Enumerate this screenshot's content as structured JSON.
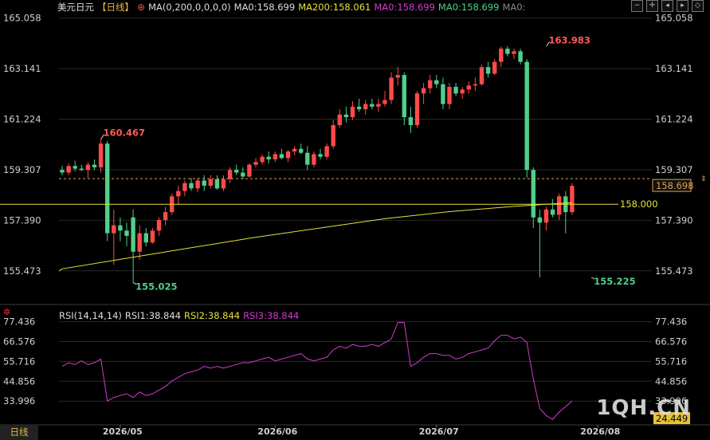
{
  "header": {
    "symbol": "美元日元",
    "period": "【日线】",
    "ma_params": "MA(0,200,0,0,0,0)",
    "ma0_label": "MA0:158.699",
    "ma200_label": "MA200:158.061",
    "ma0_label_2": "MA0:158.699",
    "ma0_label_3": "MA0:158.699",
    "ma0_label_4": "MA0:"
  },
  "rsi_header": {
    "params": "RSI(14,14,14)",
    "rsi1": "RSI1:38.844",
    "rsi2": "RSI2:38.844",
    "rsi3": "RSI3:38.844"
  },
  "bottom_tab": "日线",
  "watermark": "1QH.CN",
  "colors": {
    "up": "#ff4a4a",
    "down": "#4fd08a",
    "ma200": "#e6e03a",
    "rsi": "#d43bd1",
    "grid": "#2a2a2a",
    "support": "#e6e03a",
    "price_dash": "#e0a050"
  },
  "chart_data": [
    {
      "type": "candlestick",
      "y_ticks": [
        "165.058",
        "163.141",
        "161.224",
        "159.307",
        "157.390",
        "155.473"
      ],
      "ylim": [
        154.5,
        165.2
      ],
      "x_ticks": [
        "2026/05",
        "2026/06",
        "2026/07",
        "2026/08"
      ],
      "x_tick_index": [
        9,
        33,
        58,
        83
      ],
      "last_price": "158.698",
      "support_level": 158.0,
      "support_label": "158.000",
      "annotations": [
        {
          "text": "160.467",
          "index": 6,
          "value": 160.467,
          "kind": "high"
        },
        {
          "text": "155.025",
          "index": 11,
          "value": 155.025,
          "kind": "low"
        },
        {
          "text": "163.983",
          "index": 75,
          "value": 163.983,
          "kind": "high"
        },
        {
          "text": "155.225",
          "index": 82,
          "value": 155.225,
          "kind": "low"
        }
      ],
      "ohlc": [
        [
          159.3,
          159.45,
          159.1,
          159.2
        ],
        [
          159.2,
          159.55,
          159.1,
          159.45
        ],
        [
          159.45,
          159.65,
          159.25,
          159.35
        ],
        [
          159.35,
          159.5,
          159.25,
          159.3
        ],
        [
          159.3,
          159.6,
          159.0,
          159.5
        ],
        [
          159.5,
          159.7,
          159.3,
          159.4
        ],
        [
          159.4,
          160.467,
          159.2,
          160.3
        ],
        [
          160.3,
          160.4,
          156.6,
          156.9
        ],
        [
          156.9,
          157.8,
          155.7,
          157.2
        ],
        [
          157.2,
          157.5,
          156.6,
          157.0
        ],
        [
          157.0,
          157.3,
          156.4,
          156.8
        ],
        [
          157.5,
          157.8,
          155.025,
          156.2
        ],
        [
          156.2,
          157.2,
          155.9,
          156.9
        ],
        [
          156.9,
          157.1,
          156.4,
          156.55
        ],
        [
          156.55,
          157.1,
          156.5,
          157.0
        ],
        [
          157.0,
          157.5,
          156.8,
          157.4
        ],
        [
          157.4,
          157.9,
          157.2,
          157.7
        ],
        [
          157.7,
          158.4,
          157.6,
          158.3
        ],
        [
          158.3,
          158.7,
          158.0,
          158.5
        ],
        [
          158.5,
          158.9,
          158.3,
          158.8
        ],
        [
          158.8,
          159.0,
          158.5,
          158.6
        ],
        [
          158.6,
          159.0,
          158.45,
          158.9
        ],
        [
          158.9,
          159.1,
          158.5,
          158.7
        ],
        [
          158.7,
          159.1,
          158.6,
          158.95
        ],
        [
          158.95,
          159.1,
          158.55,
          158.6
        ],
        [
          158.6,
          159.1,
          158.5,
          158.95
        ],
        [
          158.95,
          159.4,
          158.8,
          159.3
        ],
        [
          159.3,
          159.5,
          159.1,
          159.2
        ],
        [
          159.2,
          159.4,
          158.95,
          159.05
        ],
        [
          159.05,
          159.55,
          159.0,
          159.5
        ],
        [
          159.5,
          159.75,
          159.4,
          159.6
        ],
        [
          159.6,
          159.9,
          159.5,
          159.8
        ],
        [
          159.8,
          160.0,
          159.55,
          159.7
        ],
        [
          159.7,
          160.0,
          159.6,
          159.9
        ],
        [
          159.9,
          160.1,
          159.7,
          159.75
        ],
        [
          159.75,
          160.05,
          159.6,
          160.0
        ],
        [
          160.0,
          160.2,
          159.85,
          160.1
        ],
        [
          160.1,
          160.3,
          159.9,
          159.95
        ],
        [
          159.95,
          160.2,
          159.3,
          159.5
        ],
        [
          159.5,
          160.0,
          159.4,
          159.9
        ],
        [
          159.9,
          160.1,
          159.7,
          159.8
        ],
        [
          159.8,
          160.3,
          159.7,
          160.2
        ],
        [
          160.2,
          161.2,
          160.1,
          161.0
        ],
        [
          161.0,
          161.6,
          160.9,
          161.4
        ],
        [
          161.4,
          161.7,
          161.1,
          161.3
        ],
        [
          161.3,
          161.9,
          161.2,
          161.7
        ],
        [
          161.7,
          162.0,
          161.5,
          161.6
        ],
        [
          161.6,
          161.95,
          161.4,
          161.8
        ],
        [
          161.8,
          162.0,
          161.6,
          161.7
        ],
        [
          161.7,
          162.0,
          161.5,
          161.8
        ],
        [
          161.8,
          162.3,
          161.7,
          161.95
        ],
        [
          161.95,
          163.0,
          161.8,
          162.8
        ],
        [
          162.8,
          163.2,
          162.5,
          162.9
        ],
        [
          162.9,
          163.0,
          161.0,
          161.3
        ],
        [
          161.3,
          161.7,
          160.7,
          161.0
        ],
        [
          161.0,
          162.3,
          160.9,
          162.2
        ],
        [
          162.2,
          162.6,
          161.8,
          162.4
        ],
        [
          162.4,
          162.9,
          162.2,
          162.7
        ],
        [
          162.7,
          162.9,
          162.4,
          162.55
        ],
        [
          162.55,
          162.8,
          161.6,
          161.8
        ],
        [
          161.8,
          162.6,
          161.6,
          162.45
        ],
        [
          162.45,
          162.6,
          162.1,
          162.2
        ],
        [
          162.2,
          162.45,
          162.0,
          162.35
        ],
        [
          162.35,
          162.65,
          162.2,
          162.5
        ],
        [
          162.5,
          162.8,
          162.3,
          162.55
        ],
        [
          162.55,
          163.3,
          162.5,
          163.2
        ],
        [
          163.2,
          163.4,
          162.8,
          162.95
        ],
        [
          162.95,
          163.5,
          162.9,
          163.4
        ],
        [
          163.4,
          163.983,
          163.2,
          163.9
        ],
        [
          163.9,
          164.0,
          163.6,
          163.7
        ],
        [
          163.7,
          163.9,
          163.5,
          163.8
        ],
        [
          163.8,
          163.9,
          163.3,
          163.4
        ],
        [
          163.4,
          163.5,
          159.0,
          159.3
        ],
        [
          159.3,
          159.4,
          157.1,
          157.5
        ],
        [
          157.5,
          157.8,
          155.225,
          157.3
        ],
        [
          157.3,
          157.9,
          157.0,
          157.8
        ],
        [
          157.8,
          158.2,
          157.5,
          157.6
        ],
        [
          157.6,
          158.4,
          157.4,
          158.3
        ],
        [
          158.3,
          158.5,
          156.9,
          157.7
        ],
        [
          157.7,
          158.8,
          157.6,
          158.698
        ]
      ],
      "ma200": [
        [
          0,
          155.55
        ],
        [
          10,
          155.95
        ],
        [
          20,
          156.35
        ],
        [
          30,
          156.75
        ],
        [
          40,
          157.1
        ],
        [
          50,
          157.45
        ],
        [
          60,
          157.72
        ],
        [
          70,
          157.92
        ],
        [
          75,
          158.0
        ],
        [
          79,
          158.06
        ]
      ]
    },
    {
      "type": "line",
      "name": "RSI",
      "y_ticks": [
        "77.436",
        "66.576",
        "55.716",
        "44.856",
        "33.996",
        "24.449"
      ],
      "ylim": [
        21.0,
        79.0
      ],
      "last_label": "24.449",
      "values": [
        53,
        55,
        54,
        56,
        54,
        55,
        57,
        34,
        36,
        37,
        38,
        36,
        39,
        37,
        38,
        40,
        42,
        45,
        47,
        49,
        50,
        51,
        53,
        52,
        53,
        52,
        53,
        54,
        55,
        55,
        56,
        57,
        58,
        56,
        57,
        58,
        59,
        60,
        57,
        56,
        57,
        58,
        62,
        64,
        63,
        65,
        64,
        64,
        65,
        64,
        66,
        68,
        77,
        77,
        53,
        55,
        58,
        60,
        60,
        59,
        59,
        57,
        58,
        60,
        61,
        62,
        63,
        67,
        70,
        70,
        68,
        69,
        66,
        46,
        30,
        26,
        24,
        28,
        31,
        34
      ]
    }
  ]
}
